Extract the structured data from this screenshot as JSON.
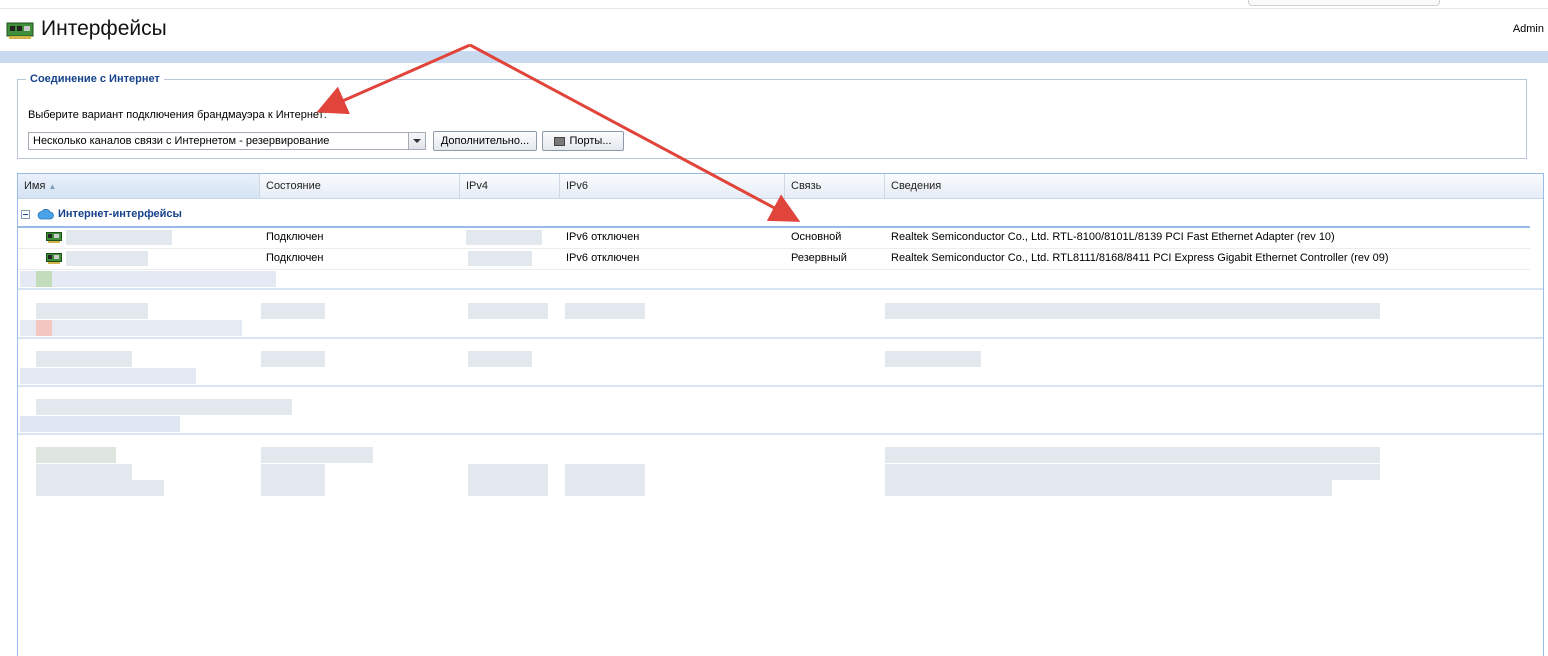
{
  "app": {
    "title": "Интерфейсы",
    "user": "Admin"
  },
  "connection": {
    "legend": "Соединение с Интернет",
    "label": "Выберите вариант подключения брандмауэра к Интернет:",
    "select_value": "Несколько каналов связи с Интернетом - резервирование",
    "advanced_button": "Дополнительно...",
    "ports_button": "Порты..."
  },
  "grid": {
    "columns": [
      "Имя",
      "Состояние",
      "IPv4",
      "IPv6",
      "Связь",
      "Сведения"
    ],
    "sorted_column": "Имя",
    "group_title": "Интернет-интерфейсы",
    "rows": [
      {
        "name": "",
        "state": "Подключен",
        "ipv4": "",
        "ipv6": "IPv6 отключен",
        "link": "Основной",
        "details": "Realtek Semiconductor Co., Ltd. RTL-8100/8101L/8139 PCI Fast Ethernet Adapter (rev 10)"
      },
      {
        "name": "",
        "state": "Подключен",
        "ipv4": "",
        "ipv6": "IPv6 отключен",
        "link": "Резервный",
        "details": "Realtek Semiconductor Co., Ltd. RTL8111/8168/8411 PCI Express Gigabit Ethernet Controller (rev 09)"
      }
    ]
  },
  "colors": {
    "accent": "#15428b",
    "grid_border": "#99bbe8",
    "annotation_arrow": "#e0443a"
  }
}
